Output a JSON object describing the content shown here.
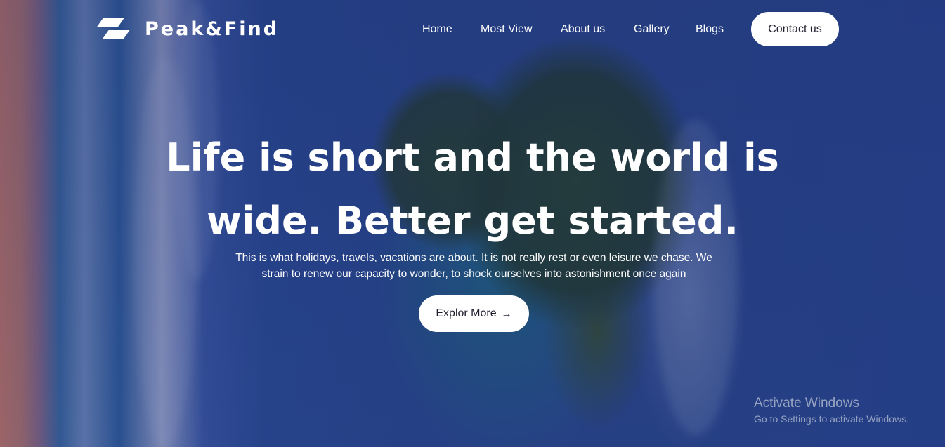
{
  "brand": {
    "name": "Peak&Find",
    "logo_icon": "parallelogram-logo-icon"
  },
  "nav": {
    "items": [
      {
        "label": "Home"
      },
      {
        "label": "Most View"
      },
      {
        "label": "About us"
      },
      {
        "label": "Gallery"
      },
      {
        "label": "Blogs"
      }
    ],
    "contact_label": "Contact us"
  },
  "hero": {
    "headline_line1": "Life is short and the world is",
    "headline_line2": "wide. Better get started.",
    "subtitle": "This is what holidays, travels, vacations are about. It is not really rest or even leisure we chase. We strain to renew our capacity to wonder, to shock ourselves into astonishment once again",
    "cta_label": "Explor More",
    "cta_icon": "arrow-right-icon",
    "cta_arrow": "→"
  },
  "watermark": {
    "title": "Activate Windows",
    "subtitle": "Go to Settings to activate Windows."
  },
  "colors": {
    "overlay": "#1f2f6a",
    "button_bg": "#ffffff",
    "text": "#ffffff"
  }
}
